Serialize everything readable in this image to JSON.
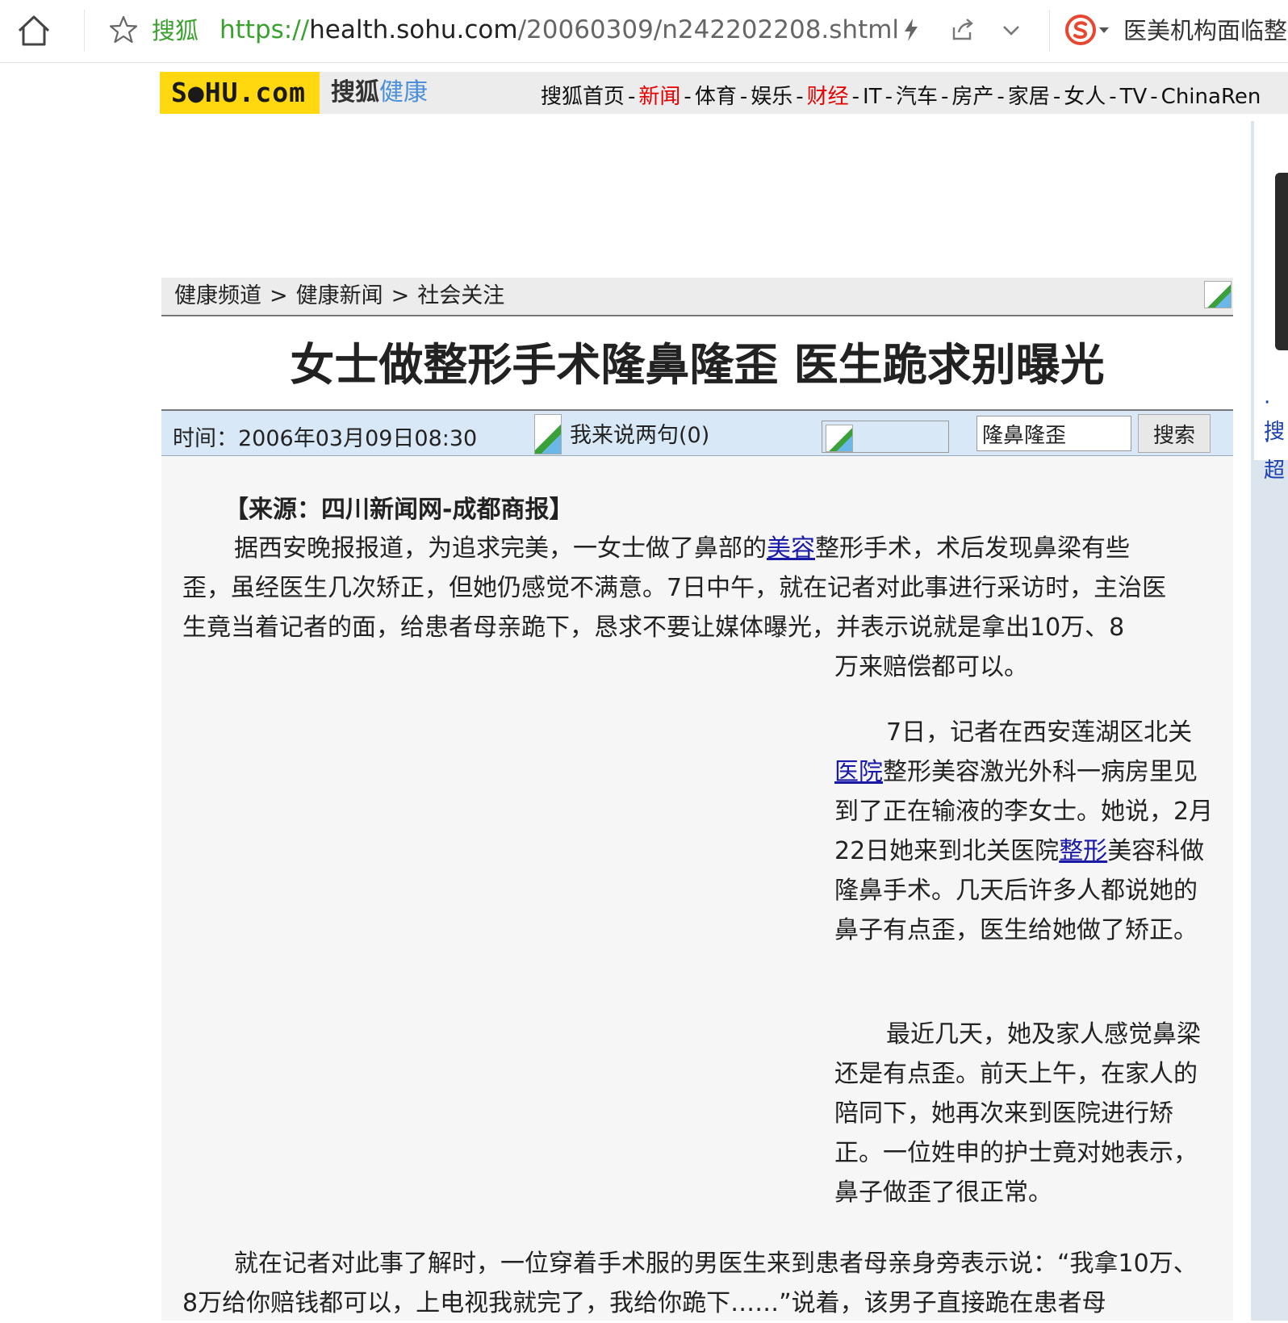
{
  "browser": {
    "site_name": "搜狐",
    "url_proto": "https://",
    "url_host": "health.sohu.com",
    "url_path": "/20060309/n242202208.shtml",
    "search_text": "医美机构面临整"
  },
  "header": {
    "logo": "S●HU.com",
    "channel_a": "搜狐",
    "channel_b": "健康",
    "nav": [
      "搜狐首页",
      "新闻",
      "体育",
      "娱乐",
      "财经",
      "IT",
      "汽车",
      "房产",
      "家居",
      "女人",
      "TV",
      "ChinaRen"
    ]
  },
  "right_col": {
    "links": [
      "·搜",
      "·超"
    ]
  },
  "breadcrumb": {
    "items": [
      "健康频道",
      "健康新闻",
      "社会关注"
    ],
    "sep": ">"
  },
  "article": {
    "title": "女士做整形手术隆鼻隆歪 医生跪求别曝光",
    "time": "时间：2006年03月09日08:30",
    "comment": "我来说两句(0)",
    "search_value": "隆鼻隆歪",
    "search_button": "搜索",
    "source": "【来源：四川新闻网-成都商报】",
    "p1_a": "据西安晚报报道，为追求完美，一女士做了鼻部的",
    "p1_link": "美容",
    "p1_b": "整形手术，术后发现鼻梁有些歪，虽经医生几次矫正，但她仍感觉不满意。7日中午，就在记者对此事进行采访时，主治医生竟当着记者的面，给患者母亲跪下，恳求不要让媒体曝光，并表示说就是拿出10万、8",
    "p1_c": "万来赔偿都可以。",
    "p2_a": "7日，记者在西安莲湖区北关",
    "p2_link1": "医院",
    "p2_b": "整形美容激光外科一病房里见到了正在输液的李女士。她说，2月22日她来到北关医院",
    "p2_link2": "整形",
    "p2_c": "美容科做隆鼻手术。几天后许多人都说她的鼻子有点歪，医生给她做了矫正。",
    "p3": "最近几天，她及家人感觉鼻梁还是有点歪。前天上午，在家人的陪同下，她再次来到医院进行矫正。一位姓申的护士竟对她表示，鼻子做歪了很正常。",
    "p4": "就在记者对此事了解时，一位穿着手术服的男医生来到患者母亲身旁表示说：“我拿10万、8万给你赔钱都可以，上电视我就完了，我给你跪下……”说着，该男子直接跪在患者母"
  },
  "colors": {
    "link_green": "#3aa12f",
    "nav_red": "#e60000",
    "logo_yellow": "#ffd80f",
    "info_blue": "#d9e8f7",
    "link_blue": "#1a1aa6"
  }
}
